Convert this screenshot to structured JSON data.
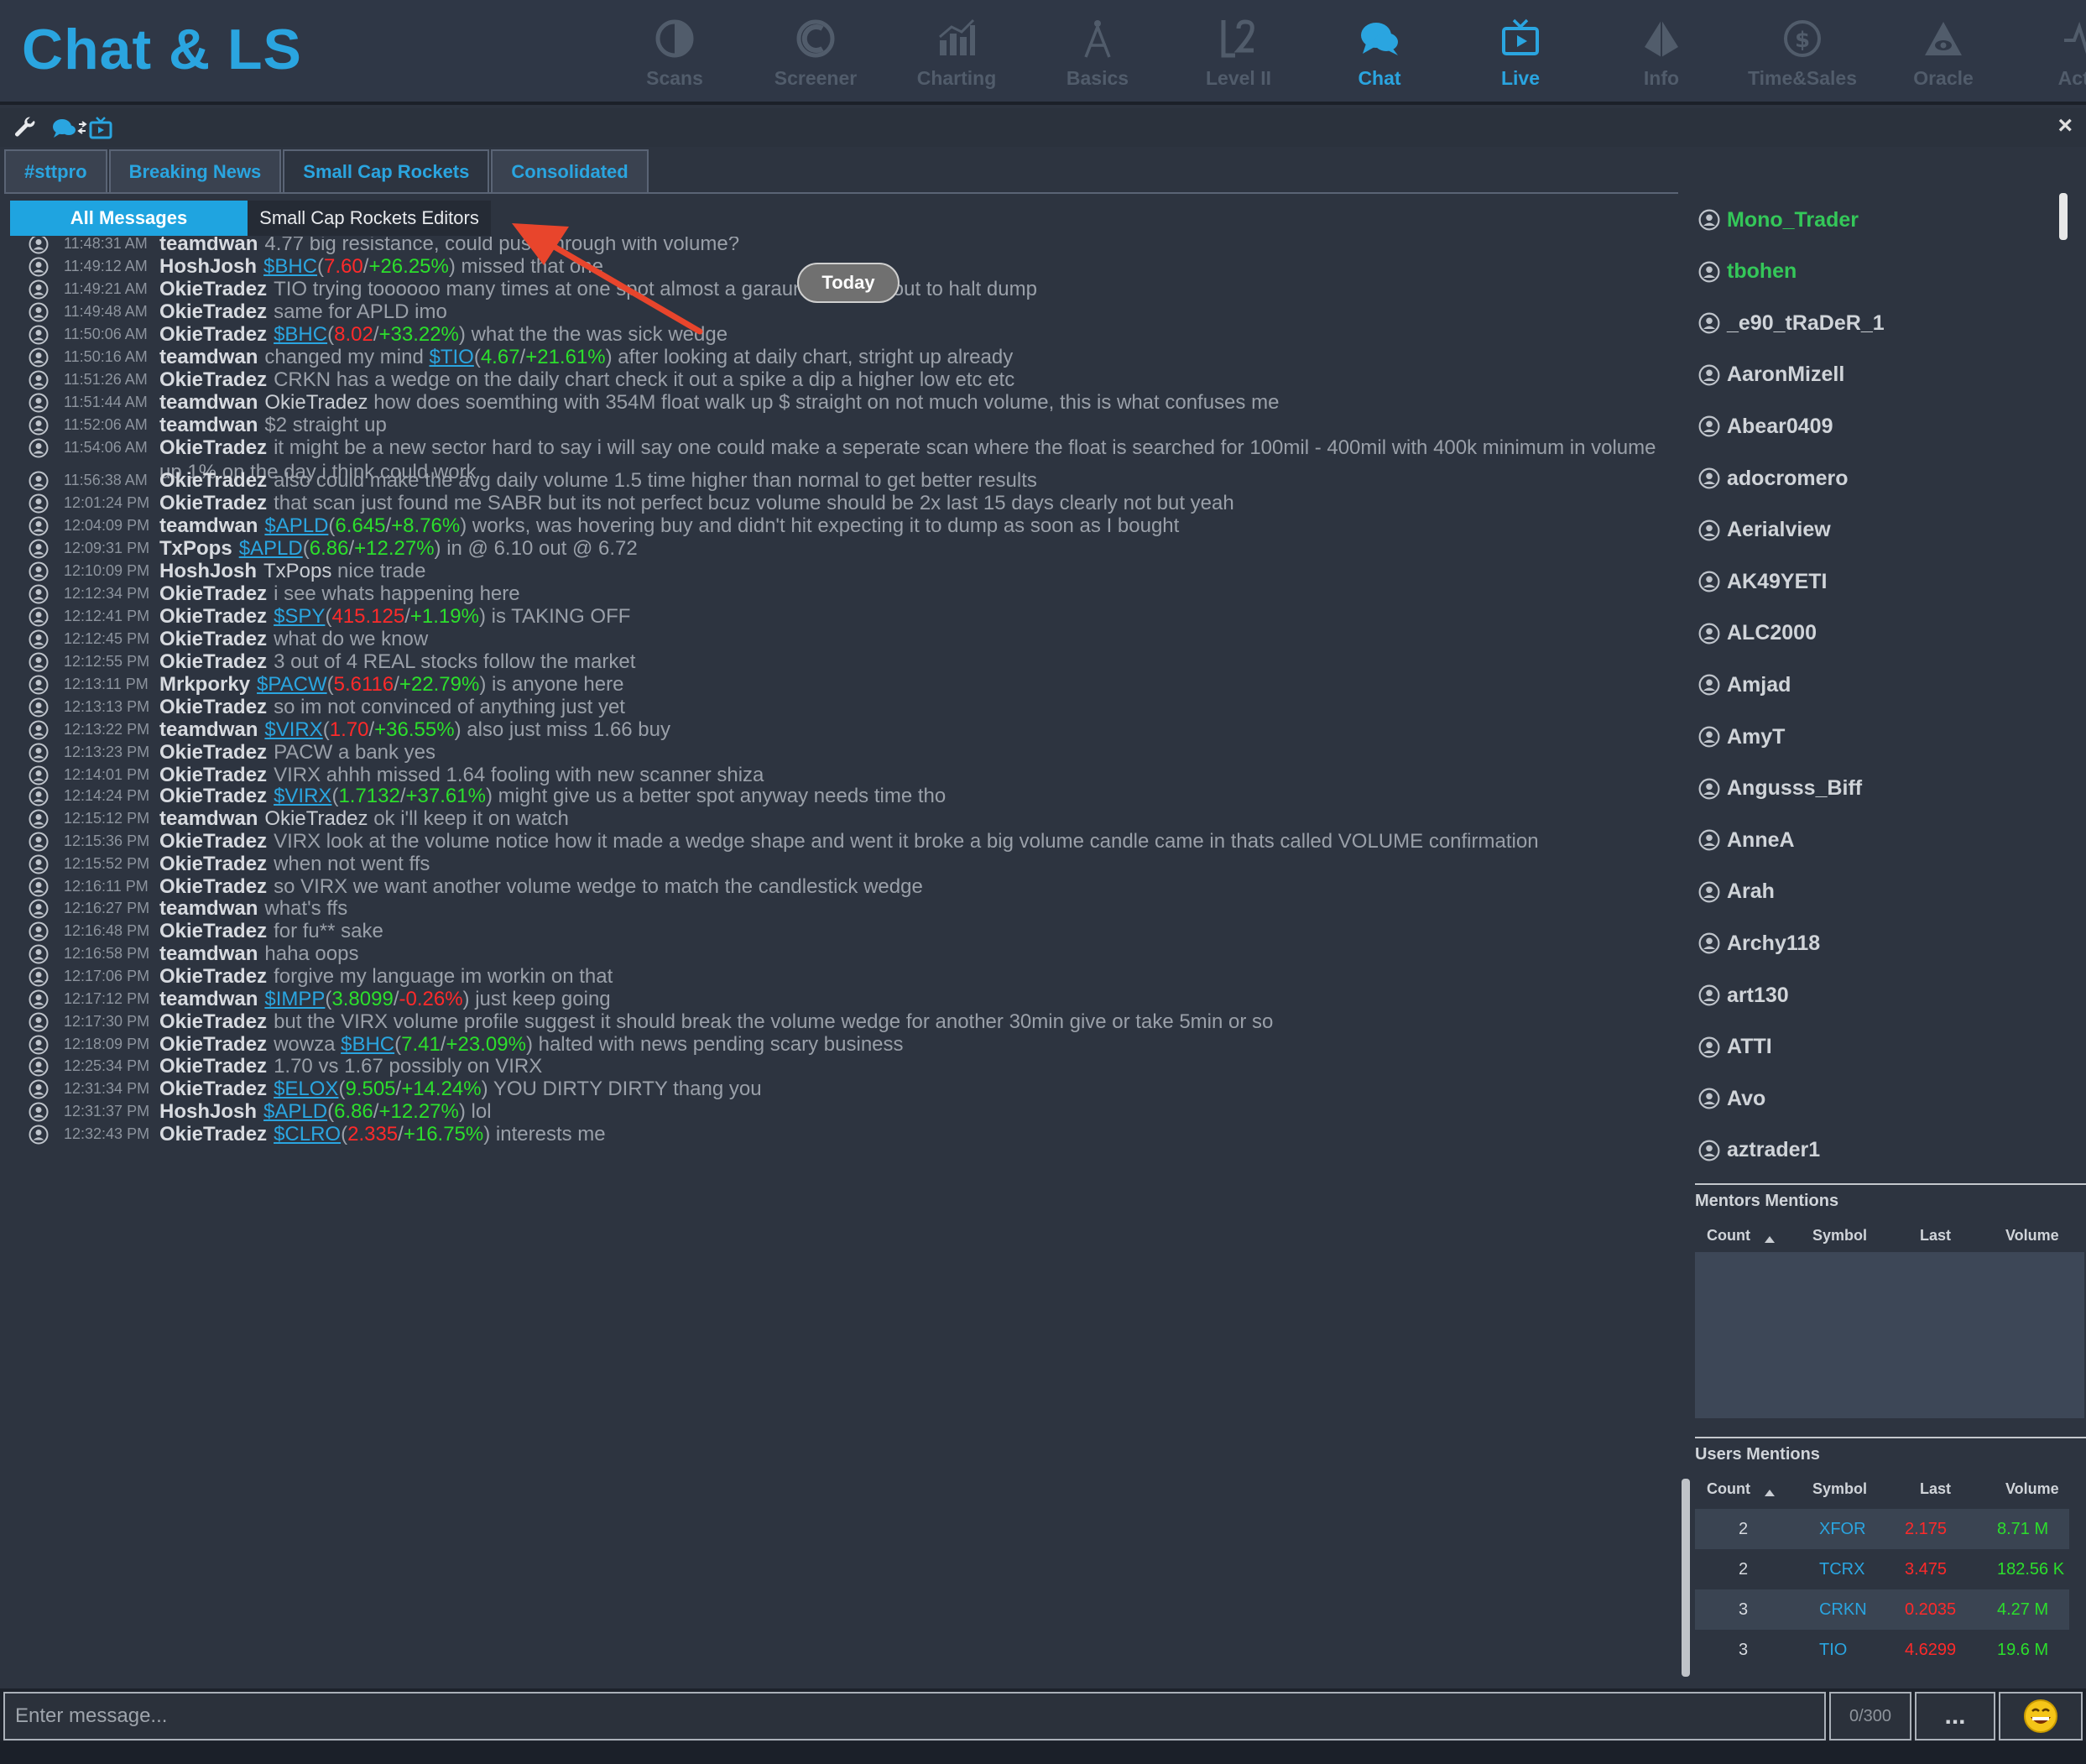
{
  "header": {
    "title": "Chat & LS",
    "nav": [
      {
        "label": "Scans",
        "icon": "scans-icon"
      },
      {
        "label": "Screener",
        "icon": "screener-icon"
      },
      {
        "label": "Charting",
        "icon": "charting-icon"
      },
      {
        "label": "Basics",
        "icon": "basics-icon"
      },
      {
        "label": "Level II",
        "icon": "level2-icon"
      },
      {
        "label": "Chat",
        "icon": "chat-icon"
      },
      {
        "label": "Live",
        "icon": "live-tv-icon"
      },
      {
        "label": "Info",
        "icon": "info-icon"
      },
      {
        "label": "Time&Sales",
        "icon": "time-sales-icon"
      },
      {
        "label": "Oracle",
        "icon": "oracle-icon"
      },
      {
        "label": "Activi",
        "icon": "activity-icon"
      }
    ],
    "accent_color": "#2aa5e0",
    "inactive_color": "#515c6b"
  },
  "toolbar": {
    "close_label": "×"
  },
  "tabs": [
    "#sttpro",
    "Breaking News",
    "Small Cap Rockets",
    "Consolidated"
  ],
  "subtabs": {
    "all": "All Messages",
    "editors": "Small Cap Rockets Editors"
  },
  "today_label": "Today",
  "messages": [
    {
      "time": "11:48:31 AM",
      "user": "teamdwan",
      "parts": [
        {
          "t": "4.77 big resistance, could push through with volume?"
        }
      ]
    },
    {
      "time": "11:49:12 AM",
      "user": "HoshJosh",
      "parts": [
        {
          "t": "$BHC",
          "c": "tk"
        },
        {
          "t": "("
        },
        {
          "t": "7.60",
          "c": "pr"
        },
        {
          "t": "/"
        },
        {
          "t": "+26.25%",
          "c": "gn"
        },
        {
          "t": ") missed that one"
        }
      ]
    },
    {
      "time": "11:49:21 AM",
      "user": "OkieTradez",
      "parts": [
        {
          "t": "TIO trying toooooo many times at one spot almost a garaunteed fake out to halt dump"
        }
      ]
    },
    {
      "time": "11:49:48 AM",
      "user": "OkieTradez",
      "parts": [
        {
          "t": "same for APLD imo"
        }
      ]
    },
    {
      "time": "11:50:06 AM",
      "user": "OkieTradez",
      "parts": [
        {
          "t": "$BHC",
          "c": "tk"
        },
        {
          "t": "("
        },
        {
          "t": "8.02",
          "c": "pr"
        },
        {
          "t": "/"
        },
        {
          "t": "+33.22%",
          "c": "gn"
        },
        {
          "t": ") what the the was sick wedge"
        }
      ]
    },
    {
      "time": "11:50:16 AM",
      "user": "teamdwan",
      "parts": [
        {
          "t": "changed my mind "
        },
        {
          "t": "$TIO",
          "c": "tk"
        },
        {
          "t": "("
        },
        {
          "t": "4.67",
          "c": "gn"
        },
        {
          "t": "/"
        },
        {
          "t": "+21.61%",
          "c": "gn"
        },
        {
          "t": ") after looking at daily chart, stright up already"
        }
      ]
    },
    {
      "time": "11:51:26 AM",
      "user": "OkieTradez",
      "parts": [
        {
          "t": "CRKN has a wedge on the daily chart check it out a spike a dip a higher low etc etc"
        }
      ]
    },
    {
      "time": "11:51:44 AM",
      "user": "teamdwan",
      "parts": [
        {
          "t": "OkieTradez",
          "c": "wt"
        },
        {
          "t": " how does soemthing with 354M float walk up $ straight on not much volume, this is what confuses me"
        }
      ]
    },
    {
      "time": "11:52:06 AM",
      "user": "teamdwan",
      "parts": [
        {
          "t": "$2 straight up"
        }
      ]
    },
    {
      "time": "11:54:06 AM",
      "user": "OkieTradez",
      "parts": [
        {
          "t": "it might be a new sector hard to say i will say one could make a seperate scan where the float is searched for 100mil - 400mil with 400k minimum in volume up 1% on the day i think could work"
        }
      ]
    },
    {
      "time": "11:56:38 AM",
      "user": "OkieTradez",
      "parts": [
        {
          "t": "also could make the avg daily volume 1.5 time higher than normal to get better results"
        }
      ]
    },
    {
      "time": "12:01:24 PM",
      "user": "OkieTradez",
      "parts": [
        {
          "t": "that scan just found me SABR but its not perfect bcuz volume should be 2x last 15 days clearly not but yeah"
        }
      ]
    },
    {
      "time": "12:04:09 PM",
      "user": "teamdwan",
      "parts": [
        {
          "t": "$APLD",
          "c": "tk"
        },
        {
          "t": "("
        },
        {
          "t": "6.645",
          "c": "gn"
        },
        {
          "t": "/"
        },
        {
          "t": "+8.76%",
          "c": "gn"
        },
        {
          "t": ") works, was hovering buy and didn't hit expecting it to dump as soon as I bought"
        }
      ]
    },
    {
      "time": "12:09:31 PM",
      "user": "TxPops",
      "parts": [
        {
          "t": "$APLD",
          "c": "tk"
        },
        {
          "t": "("
        },
        {
          "t": "6.86",
          "c": "gn"
        },
        {
          "t": "/"
        },
        {
          "t": "+12.27%",
          "c": "gn"
        },
        {
          "t": ") in @ 6.10 out @ 6.72"
        }
      ]
    },
    {
      "time": "12:10:09 PM",
      "user": "HoshJosh",
      "parts": [
        {
          "t": "TxPops",
          "c": "wt"
        },
        {
          "t": " nice trade"
        }
      ]
    },
    {
      "time": "12:12:34 PM",
      "user": "OkieTradez",
      "parts": [
        {
          "t": "i see whats happening here"
        }
      ]
    },
    {
      "time": "12:12:41 PM",
      "user": "OkieTradez",
      "parts": [
        {
          "t": "$SPY",
          "c": "tk"
        },
        {
          "t": "("
        },
        {
          "t": "415.125",
          "c": "pr"
        },
        {
          "t": "/"
        },
        {
          "t": "+1.19%",
          "c": "gn"
        },
        {
          "t": ") is TAKING OFF"
        }
      ]
    },
    {
      "time": "12:12:45 PM",
      "user": "OkieTradez",
      "parts": [
        {
          "t": "what do we know"
        }
      ]
    },
    {
      "time": "12:12:55 PM",
      "user": "OkieTradez",
      "parts": [
        {
          "t": "3 out of 4 REAL stocks follow the market"
        }
      ]
    },
    {
      "time": "12:13:11 PM",
      "user": "Mrkporky",
      "parts": [
        {
          "t": "$PACW",
          "c": "tk"
        },
        {
          "t": "("
        },
        {
          "t": "5.6116",
          "c": "pr"
        },
        {
          "t": "/"
        },
        {
          "t": "+22.79%",
          "c": "gn"
        },
        {
          "t": ") is anyone here"
        }
      ]
    },
    {
      "time": "12:13:13 PM",
      "user": "OkieTradez",
      "parts": [
        {
          "t": "so im not convinced of anything just yet"
        }
      ]
    },
    {
      "time": "12:13:22 PM",
      "user": "teamdwan",
      "parts": [
        {
          "t": "$VIRX",
          "c": "tk"
        },
        {
          "t": "("
        },
        {
          "t": "1.70",
          "c": "pr"
        },
        {
          "t": "/"
        },
        {
          "t": "+36.55%",
          "c": "gn"
        },
        {
          "t": ") also just miss 1.66 buy"
        }
      ]
    },
    {
      "time": "12:13:23 PM",
      "user": "OkieTradez",
      "parts": [
        {
          "t": "PACW a bank yes"
        }
      ]
    },
    {
      "time": "12:14:01 PM",
      "user": "OkieTradez",
      "parts": [
        {
          "t": "VIRX ahhh missed 1.64 fooling with new scanner shiza"
        }
      ]
    },
    {
      "time": "12:14:24 PM",
      "user": "OkieTradez",
      "parts": [
        {
          "t": "$VIRX",
          "c": "tk"
        },
        {
          "t": "("
        },
        {
          "t": "1.7132",
          "c": "gn"
        },
        {
          "t": "/"
        },
        {
          "t": "+37.61%",
          "c": "gn"
        },
        {
          "t": ") might give us a better spot anyway needs time tho"
        }
      ]
    },
    {
      "time": "12:15:12 PM",
      "user": "teamdwan",
      "parts": [
        {
          "t": "OkieTradez",
          "c": "wt"
        },
        {
          "t": " ok i'll keep it on watch"
        }
      ]
    },
    {
      "time": "12:15:36 PM",
      "user": "OkieTradez",
      "parts": [
        {
          "t": "VIRX look at the volume notice how it made a wedge shape and went it broke a big volume candle came in thats called VOLUME confirmation"
        }
      ]
    },
    {
      "time": "12:15:52 PM",
      "user": "OkieTradez",
      "parts": [
        {
          "t": "when not went ffs"
        }
      ]
    },
    {
      "time": "12:16:11 PM",
      "user": "OkieTradez",
      "parts": [
        {
          "t": "so VIRX we want another volume wedge to match the candlestick wedge"
        }
      ]
    },
    {
      "time": "12:16:27 PM",
      "user": "teamdwan",
      "parts": [
        {
          "t": "what's ffs"
        }
      ]
    },
    {
      "time": "12:16:48 PM",
      "user": "OkieTradez",
      "parts": [
        {
          "t": "for fu** sake"
        }
      ]
    },
    {
      "time": "12:16:58 PM",
      "user": "teamdwan",
      "parts": [
        {
          "t": "haha oops"
        }
      ]
    },
    {
      "time": "12:17:06 PM",
      "user": "OkieTradez",
      "parts": [
        {
          "t": "forgive my language im workin on that"
        }
      ]
    },
    {
      "time": "12:17:12 PM",
      "user": "teamdwan",
      "parts": [
        {
          "t": "$IMPP",
          "c": "tk"
        },
        {
          "t": "("
        },
        {
          "t": "3.8099",
          "c": "gn"
        },
        {
          "t": "/"
        },
        {
          "t": "-0.26%",
          "c": "pr"
        },
        {
          "t": ") just keep going"
        }
      ]
    },
    {
      "time": "12:17:30 PM",
      "user": "OkieTradez",
      "parts": [
        {
          "t": "but the VIRX volume profile suggest it should break the volume wedge for another 30min give or take 5min or so"
        }
      ]
    },
    {
      "time": "12:18:09 PM",
      "user": "OkieTradez",
      "parts": [
        {
          "t": "wowza "
        },
        {
          "t": "$BHC",
          "c": "tk"
        },
        {
          "t": "("
        },
        {
          "t": "7.41",
          "c": "gn"
        },
        {
          "t": "/"
        },
        {
          "t": "+23.09%",
          "c": "gn"
        },
        {
          "t": ") halted with news pending scary business"
        }
      ]
    },
    {
      "time": "12:25:34 PM",
      "user": "OkieTradez",
      "parts": [
        {
          "t": "1.70 vs 1.67 possibly on VIRX"
        }
      ]
    },
    {
      "time": "12:31:34 PM",
      "user": "OkieTradez",
      "parts": [
        {
          "t": "$ELOX",
          "c": "tk"
        },
        {
          "t": "("
        },
        {
          "t": "9.505",
          "c": "gn"
        },
        {
          "t": "/"
        },
        {
          "t": "+14.24%",
          "c": "gn"
        },
        {
          "t": ") YOU DIRTY DIRTY thang you"
        }
      ]
    },
    {
      "time": "12:31:37 PM",
      "user": "HoshJosh",
      "parts": [
        {
          "t": "$APLD",
          "c": "tk"
        },
        {
          "t": "("
        },
        {
          "t": "6.86",
          "c": "gn"
        },
        {
          "t": "/"
        },
        {
          "t": "+12.27%",
          "c": "gn"
        },
        {
          "t": ") lol"
        }
      ]
    },
    {
      "time": "12:32:43 PM",
      "user": "OkieTradez",
      "parts": [
        {
          "t": "$CLRO",
          "c": "tk"
        },
        {
          "t": "("
        },
        {
          "t": "2.335",
          "c": "pr"
        },
        {
          "t": "/"
        },
        {
          "t": "+16.75%",
          "c": "gn"
        },
        {
          "t": ") interests me"
        }
      ]
    }
  ],
  "users": [
    {
      "name": "Mono_Trader",
      "online": true
    },
    {
      "name": "tbohen",
      "online": true
    },
    {
      "name": "_e90_tRaDeR_1",
      "online": false
    },
    {
      "name": "AaronMizell",
      "online": false
    },
    {
      "name": "Abear0409",
      "online": false
    },
    {
      "name": "adocromero",
      "online": false
    },
    {
      "name": "Aerialview",
      "online": false
    },
    {
      "name": "AK49YETI",
      "online": false
    },
    {
      "name": "ALC2000",
      "online": false
    },
    {
      "name": "Amjad",
      "online": false
    },
    {
      "name": "AmyT",
      "online": false
    },
    {
      "name": "Angusss_Biff",
      "online": false
    },
    {
      "name": "AnneA",
      "online": false
    },
    {
      "name": "Arah",
      "online": false
    },
    {
      "name": "Archy118",
      "online": false
    },
    {
      "name": "art130",
      "online": false
    },
    {
      "name": "ATTI",
      "online": false
    },
    {
      "name": "Avo",
      "online": false
    },
    {
      "name": "aztrader1",
      "online": false
    }
  ],
  "mentors": {
    "title": "Mentors Mentions",
    "columns": [
      "Count",
      "Symbol",
      "Last",
      "Volume"
    ],
    "sort_icon": "sort-up-icon"
  },
  "user_mentions": {
    "title": "Users Mentions",
    "columns": [
      "Count",
      "Symbol",
      "Last",
      "Volume"
    ],
    "rows": [
      {
        "count": "2",
        "symbol": "XFOR",
        "last": "2.175",
        "volume": "8.71 M"
      },
      {
        "count": "2",
        "symbol": "TCRX",
        "last": "3.475",
        "volume": "182.56 K"
      },
      {
        "count": "3",
        "symbol": "CRKN",
        "last": "0.2035",
        "volume": "4.27 M"
      },
      {
        "count": "3",
        "symbol": "TIO",
        "last": "4.6299",
        "volume": "19.6 M"
      }
    ]
  },
  "input": {
    "placeholder": "Enter message...",
    "counter": "0/300",
    "more_label": "...",
    "emoji": "😄"
  }
}
